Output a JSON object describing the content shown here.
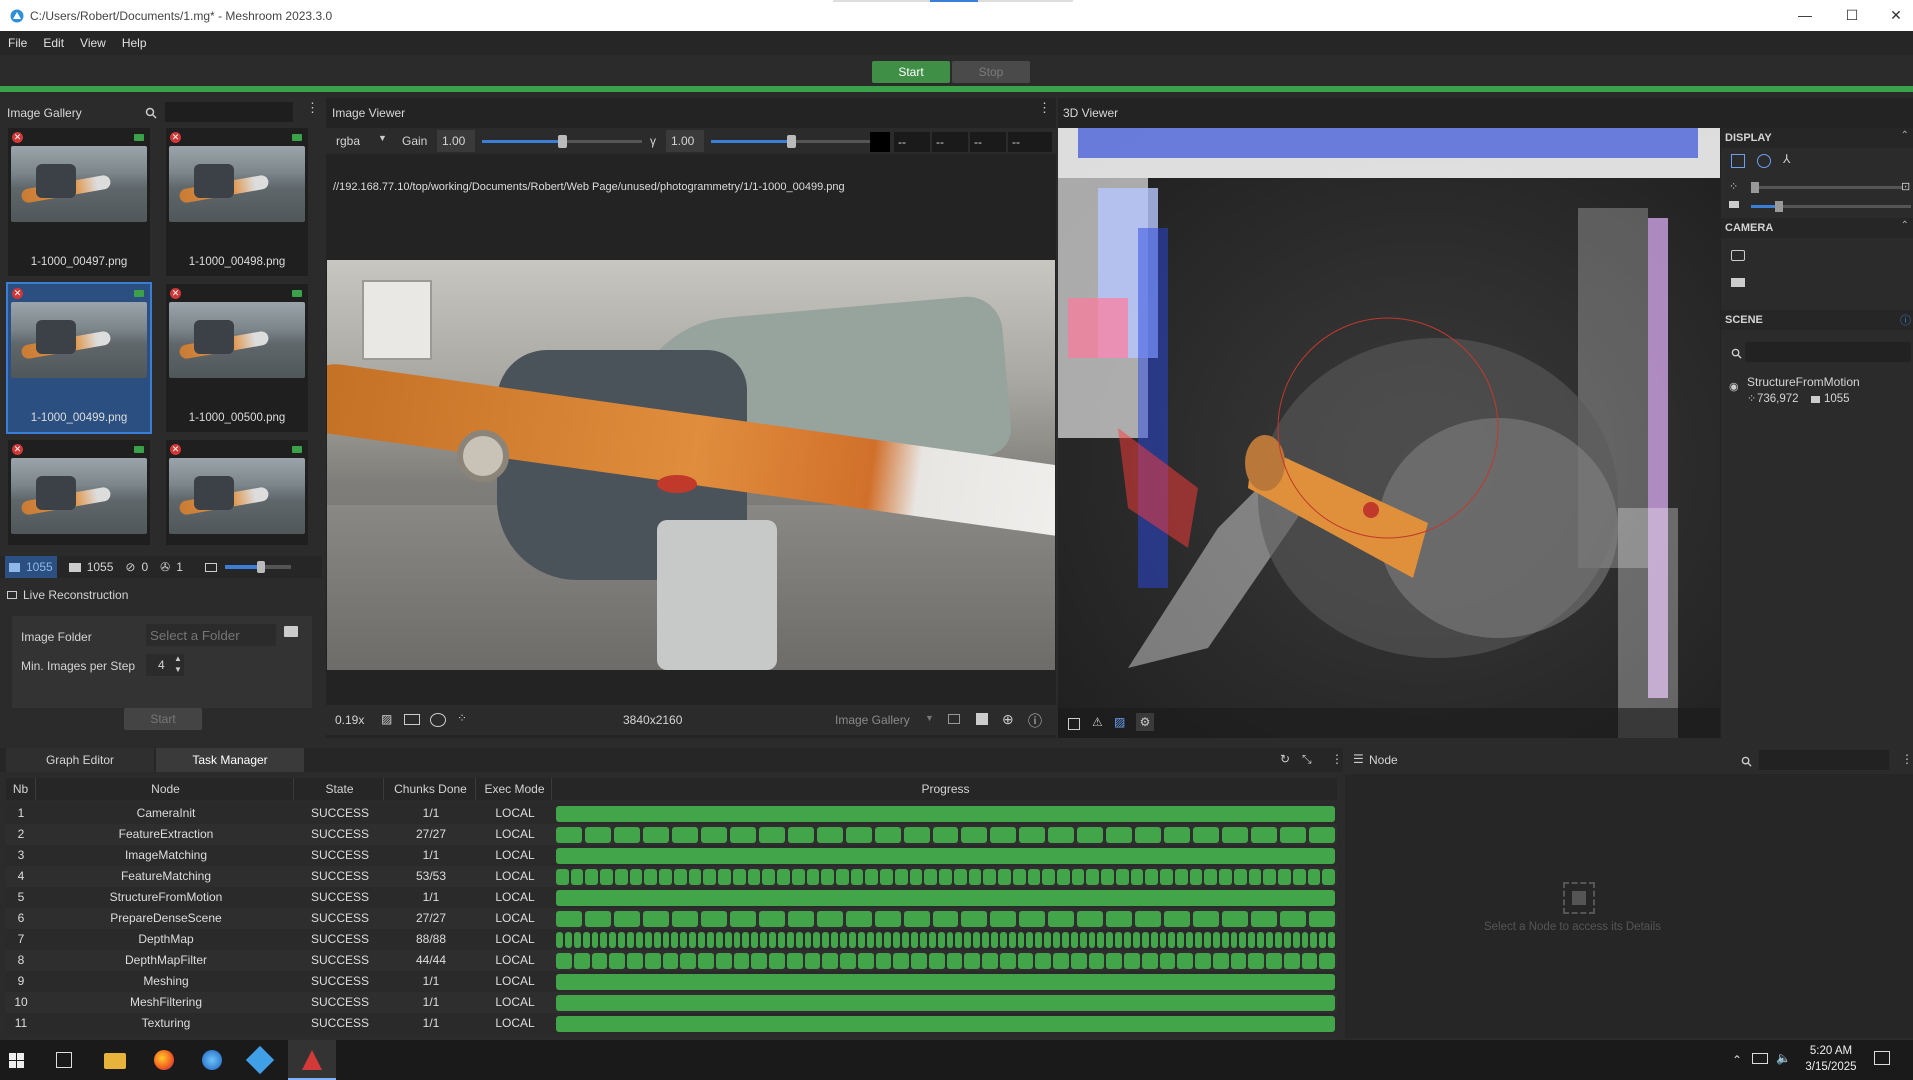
{
  "window": {
    "title": "C:/Users/Robert/Documents/1.mg* - Meshroom 2023.3.0",
    "minimize": "—",
    "maximize": "☐",
    "close": "✕"
  },
  "menu": [
    "File",
    "Edit",
    "View",
    "Help"
  ],
  "toolbar": {
    "start": "Start",
    "stop": "Stop"
  },
  "gallery": {
    "title": "Image Gallery",
    "search_placeholder": "",
    "thumbs": [
      "1-1000_00497.png",
      "1-1000_00498.png",
      "1-1000_00499.png",
      "1-1000_00500.png",
      "",
      ""
    ],
    "counts": {
      "images": "1055",
      "cameras": "1055",
      "no_cam": "0",
      "rigs": "1"
    }
  },
  "live": {
    "title": "Live Reconstruction",
    "folder_label": "Image Folder",
    "folder_placeholder": "Select a Folder",
    "min_label": "Min. Images per Step",
    "min_value": "4",
    "start": "Start"
  },
  "viewer": {
    "title": "Image Viewer",
    "channel": "rgba",
    "gain_label": "Gain",
    "gain": "1.00",
    "gamma_label": "γ",
    "gamma": "1.00",
    "pix": [
      "--",
      "--",
      "--",
      "--"
    ],
    "path": "//192.168.77.10/top/working/Documents/Robert/Web Page/unused/photogrammetry/1/1-1000_00499.png",
    "zoom": "0.19x",
    "resolution": "3840x2160",
    "source": "Image Gallery",
    "gain_level": 0.5,
    "gamma_level": 0.5
  },
  "viewer3d": {
    "title": "3D Viewer"
  },
  "side": {
    "display": "DISPLAY",
    "camera": "CAMERA",
    "scene": "SCENE",
    "scene_item": "StructureFromMotion",
    "points": "736,972",
    "cams": "1055"
  },
  "tabs": {
    "graph": "Graph Editor",
    "task": "Task Manager"
  },
  "table": {
    "headers": [
      "Nb",
      "Node",
      "State",
      "Chunks Done",
      "Exec Mode",
      "Progress"
    ],
    "rows": [
      {
        "nb": "1",
        "node": "CameraInit",
        "state": "SUCCESS",
        "chunks": "1/1",
        "mode": "LOCAL",
        "segments": 1
      },
      {
        "nb": "2",
        "node": "FeatureExtraction",
        "state": "SUCCESS",
        "chunks": "27/27",
        "mode": "LOCAL",
        "segments": 27
      },
      {
        "nb": "3",
        "node": "ImageMatching",
        "state": "SUCCESS",
        "chunks": "1/1",
        "mode": "LOCAL",
        "segments": 1
      },
      {
        "nb": "4",
        "node": "FeatureMatching",
        "state": "SUCCESS",
        "chunks": "53/53",
        "mode": "LOCAL",
        "segments": 53
      },
      {
        "nb": "5",
        "node": "StructureFromMotion",
        "state": "SUCCESS",
        "chunks": "1/1",
        "mode": "LOCAL",
        "segments": 1
      },
      {
        "nb": "6",
        "node": "PrepareDenseScene",
        "state": "SUCCESS",
        "chunks": "27/27",
        "mode": "LOCAL",
        "segments": 27
      },
      {
        "nb": "7",
        "node": "DepthMap",
        "state": "SUCCESS",
        "chunks": "88/88",
        "mode": "LOCAL",
        "segments": 88
      },
      {
        "nb": "8",
        "node": "DepthMapFilter",
        "state": "SUCCESS",
        "chunks": "44/44",
        "mode": "LOCAL",
        "segments": 44
      },
      {
        "nb": "9",
        "node": "Meshing",
        "state": "SUCCESS",
        "chunks": "1/1",
        "mode": "LOCAL",
        "segments": 1
      },
      {
        "nb": "10",
        "node": "MeshFiltering",
        "state": "SUCCESS",
        "chunks": "1/1",
        "mode": "LOCAL",
        "segments": 1
      },
      {
        "nb": "11",
        "node": "Texturing",
        "state": "SUCCESS",
        "chunks": "1/1",
        "mode": "LOCAL",
        "segments": 1
      }
    ]
  },
  "node_panel": {
    "title": "Node",
    "empty": "Select a Node to access its Details"
  },
  "clock": {
    "time": "5:20 AM",
    "date": "3/15/2025"
  },
  "colors": {
    "accent_green": "#43a54a",
    "selection_blue": "#2a4f80"
  }
}
